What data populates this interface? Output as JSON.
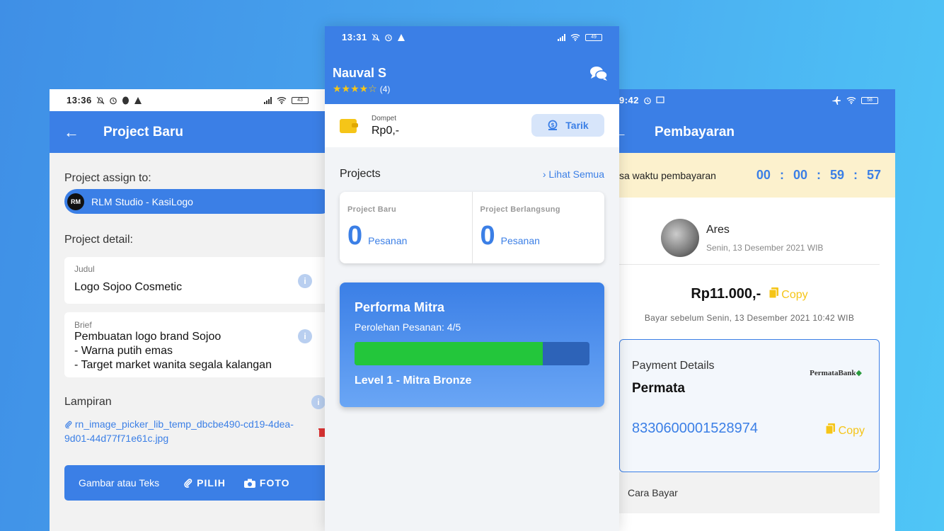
{
  "left": {
    "status": {
      "time": "13:36",
      "battery": "43"
    },
    "appbar": {
      "back": "←",
      "title": "Project Baru"
    },
    "assign_label": "Project assign to:",
    "assign": {
      "logo": "RM",
      "value": "RLM Studio - KasiLogo"
    },
    "detail_label": "Project detail:",
    "judul": {
      "label": "Judul",
      "value": "Logo Sojoo Cosmetic"
    },
    "brief": {
      "label": "Brief",
      "lines": [
        "Pembuatan logo brand Sojoo",
        "- Warna putih emas",
        "- Target market wanita segala kalangan"
      ]
    },
    "info_icon": "i",
    "lampiran_label": "Lampiran",
    "attachment": "rn_image_picker_lib_temp_dbcbe490-cd19-4dea-9d01-44d77f71e61c.jpg",
    "bottom": {
      "label": "Gambar atau Teks",
      "pilih": "PILIH",
      "foto": "FOTO"
    }
  },
  "center": {
    "status": {
      "time": "13:31",
      "battery": "49"
    },
    "user": {
      "name": "Nauval S",
      "stars": "★★★★☆",
      "rating_count": "(4)"
    },
    "wallet": {
      "label": "Dompet",
      "amount": "Rp0,-",
      "button": "Tarik"
    },
    "projects": {
      "title": "Projects",
      "see_all": "Lihat Semua",
      "baru": {
        "label": "Project Baru",
        "count": "0",
        "unit": "Pesanan"
      },
      "berlangsung": {
        "label": "Project Berlangsung",
        "count": "0",
        "unit": "Pesanan"
      }
    },
    "performance": {
      "title": "Performa Mitra",
      "subtitle": "Perolehan Pesanan: 4/5",
      "progress": 0.8,
      "level": "Level 1 - Mitra Bronze"
    }
  },
  "right": {
    "status": {
      "time": "9:42",
      "battery": "58"
    },
    "appbar": {
      "back": "←",
      "title": "Pembayaran"
    },
    "timer": {
      "label": "sa waktu pembayaran",
      "value": "00 : 00 : 59 : 57"
    },
    "payer": {
      "name": "Ares",
      "date": "Senin, 13 Desember 2021 WIB"
    },
    "amount": "Rp11.000,-",
    "copy_label": "Copy",
    "pay_before": "Bayar sebelum Senin, 13 Desember 2021 10:42 WIB",
    "payment": {
      "title": "Payment Details",
      "bank": "Permata",
      "bank_logo": "PermataBank",
      "va": "8330600001528974"
    },
    "cara_bayar": "Cara Bayar"
  },
  "colors": {
    "primary": "#3b7fe6",
    "accent": "#f5c518",
    "success": "#23c63b",
    "warning_bg": "#fcf1cd"
  }
}
